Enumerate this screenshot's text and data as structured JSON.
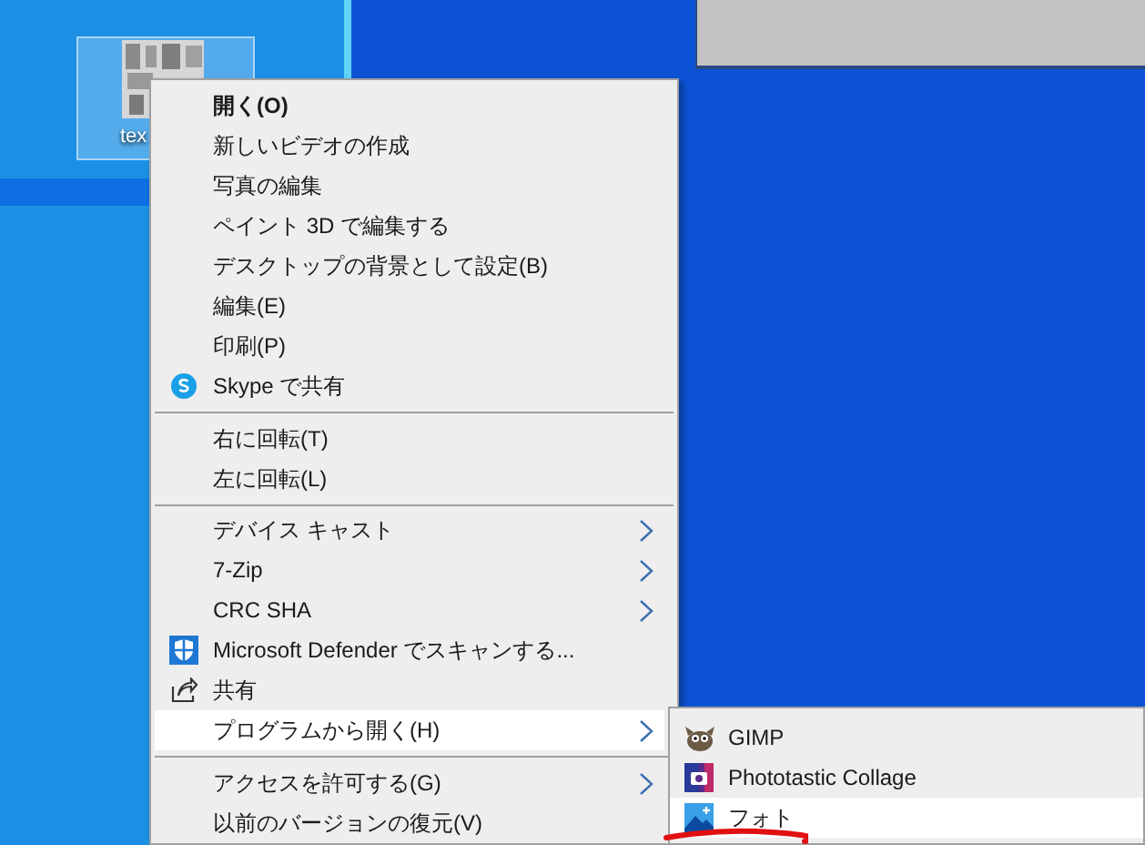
{
  "desktop": {
    "icon": {
      "label": "tex",
      "selected": true
    }
  },
  "context_menu": {
    "items": [
      {
        "kind": "item",
        "label": "開く(O)",
        "default": true,
        "submenu": false,
        "selected": false
      },
      {
        "kind": "item",
        "label": "新しいビデオの作成",
        "default": false,
        "submenu": false,
        "selected": false
      },
      {
        "kind": "item",
        "label": "写真の編集",
        "default": false,
        "submenu": false,
        "selected": false
      },
      {
        "kind": "item",
        "label": "ペイント 3D で編集する",
        "default": false,
        "submenu": false,
        "selected": false
      },
      {
        "kind": "item",
        "label": "デスクトップの背景として設定(B)",
        "default": false,
        "submenu": false,
        "selected": false
      },
      {
        "kind": "item",
        "label": "編集(E)",
        "default": false,
        "submenu": false,
        "selected": false
      },
      {
        "kind": "item",
        "label": "印刷(P)",
        "default": false,
        "submenu": false,
        "selected": false
      },
      {
        "kind": "item",
        "label": "Skype で共有",
        "default": false,
        "submenu": false,
        "selected": false
      },
      {
        "kind": "separator"
      },
      {
        "kind": "item",
        "label": "右に回転(T)",
        "default": false,
        "submenu": false,
        "selected": false
      },
      {
        "kind": "item",
        "label": "左に回転(L)",
        "default": false,
        "submenu": false,
        "selected": false
      },
      {
        "kind": "separator"
      },
      {
        "kind": "item",
        "label": "デバイス キャスト",
        "default": false,
        "submenu": true,
        "selected": false
      },
      {
        "kind": "item",
        "label": "7-Zip",
        "default": false,
        "submenu": true,
        "selected": false
      },
      {
        "kind": "item",
        "label": "CRC SHA",
        "default": false,
        "submenu": true,
        "selected": false
      },
      {
        "kind": "item",
        "label": "Microsoft Defender でスキャンする...",
        "default": false,
        "submenu": false,
        "selected": false
      },
      {
        "kind": "item",
        "label": "共有",
        "default": false,
        "submenu": false,
        "selected": false
      },
      {
        "kind": "item",
        "label": "プログラムから開く(H)",
        "default": false,
        "submenu": true,
        "selected": true
      },
      {
        "kind": "separator"
      },
      {
        "kind": "item",
        "label": "アクセスを許可する(G)",
        "default": false,
        "submenu": true,
        "selected": false
      },
      {
        "kind": "item",
        "label": "以前のバージョンの復元(V)",
        "default": false,
        "submenu": false,
        "selected": false
      }
    ]
  },
  "open_with_menu": {
    "items": [
      {
        "label": "GIMP",
        "selected": false
      },
      {
        "label": "Phototastic Collage",
        "selected": false
      },
      {
        "label": "フォト",
        "selected": true
      }
    ]
  }
}
